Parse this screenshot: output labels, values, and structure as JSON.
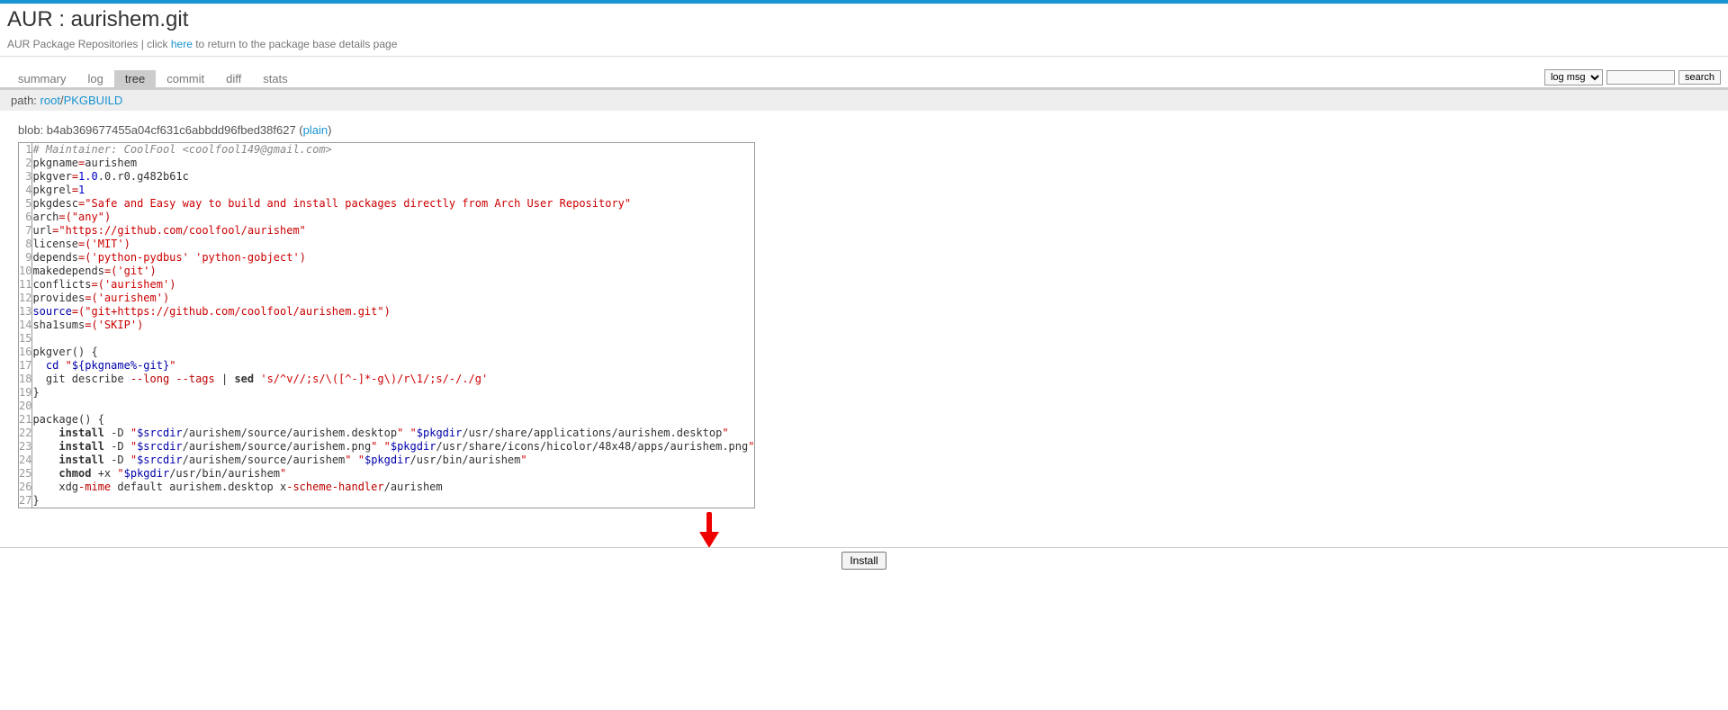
{
  "header": {
    "title": "AUR : aurishem.git",
    "subtitle_pre": "AUR Package Repositories | click ",
    "subtitle_link": "here",
    "subtitle_post": " to return to the package base details page"
  },
  "tabs": [
    "summary",
    "log",
    "tree",
    "commit",
    "diff",
    "stats"
  ],
  "active_tab": "tree",
  "search": {
    "options": [
      "log msg"
    ],
    "selected": "log msg",
    "button": "search"
  },
  "path": {
    "label": "path: ",
    "root": "root",
    "file": "PKGBUILD"
  },
  "blob": {
    "label": "blob: b4ab369677455a04cf631c6abbdd96fbed38f627 (",
    "plain": "plain",
    "close": ")"
  },
  "line_count": 27,
  "install_button": "Install",
  "code": {
    "l1_comment": "# Maintainer: CoolFool <coolfool149@gmail.com>",
    "l2_pkgname": "pkgname",
    "l2_eq": "=",
    "l2_val": "aurishem",
    "l3_pkgver": "pkgver",
    "l3_eq": "=",
    "l3_v1": "1.0",
    "l3_v2": ".0",
    "l3_v3": ".r0.g482b61c",
    "l4_pkgrel": "pkgrel",
    "l4_eq": "=",
    "l4_v": "1",
    "l5_pkgdesc": "pkgdesc",
    "l5_eq": "=",
    "l5_v": "\"Safe and Easy way to build and install packages directly from Arch User Repository\"",
    "l6_arch": "arch",
    "l6_eq": "=(",
    "l6_v": "\"any\"",
    "l6_close": ")",
    "l7_url": "url",
    "l7_eq": "=",
    "l7_v": "\"https://github.com/coolfool/aurishem\"",
    "l8_license": "license",
    "l8_eq": "=(",
    "l8_v": "'MIT'",
    "l8_close": ")",
    "l9_depends": "depends",
    "l9_eq": "=(",
    "l9_v1": "'python-pydbus'",
    "l9_sp": " ",
    "l9_v2": "'python-gobject'",
    "l9_close": ")",
    "l10_make": "makedepends",
    "l10_eq": "=(",
    "l10_v": "'git'",
    "l10_close": ")",
    "l11_conf": "conflicts",
    "l11_eq": "=(",
    "l11_v": "'aurishem'",
    "l11_close": ")",
    "l12_prov": "provides",
    "l12_eq": "=(",
    "l12_v": "'aurishem'",
    "l12_close": ")",
    "l13_source": "source",
    "l13_eq": "=(",
    "l13_v": "\"git+https://github.com/coolfool/aurishem.git\"",
    "l13_close": ")",
    "l14_sha": "sha1sums",
    "l14_eq": "=(",
    "l14_v": "'SKIP'",
    "l14_close": ")",
    "l16": "pkgver() {",
    "l17_cd": "cd",
    "l17_sp": " ",
    "l17_q": "\"",
    "l17_var": "${pkgname%-git}",
    "l17_q2": "\"",
    "l18_pre": "  git describe ",
    "l18_long": "--long --tags",
    "l18_pipe": " | ",
    "l18_sed": "sed",
    "l18_sp": " ",
    "l18_arg": "'s/^v//;s/\\([^-]*-g\\)/r\\1/;s/-/./g'",
    "l19": "}",
    "l21": "package() {",
    "l22_indent": "    ",
    "l22_install": "install",
    "l22_d": " -D ",
    "l22_q": "\"",
    "l22_src": "$srcdir",
    "l22_p1": "/aurishem/source/aurishem.desktop",
    "l22_q2": "\" \"",
    "l22_pkg": "$pkgdir",
    "l22_p2": "/usr/share/applications/aurishem.desktop",
    "l22_q3": "\"",
    "l23_p1": "/aurishem/source/aurishem.png",
    "l23_p2": "/usr/share/icons/hicolor/48x48/apps/aurishem.png",
    "l24_p1": "/aurishem/source/aurishem",
    "l24_p2": "/usr/bin/aurishem",
    "l25_chmod": "chmod",
    "l25_x": " +x ",
    "l25_p": "/usr/bin/aurishem",
    "l26_pre": "    xdg",
    "l26_mime": "-mime",
    "l26_mid": " default aurishem.desktop x",
    "l26_sh": "-scheme-handler",
    "l26_end": "/aurishem",
    "l27": "}"
  }
}
